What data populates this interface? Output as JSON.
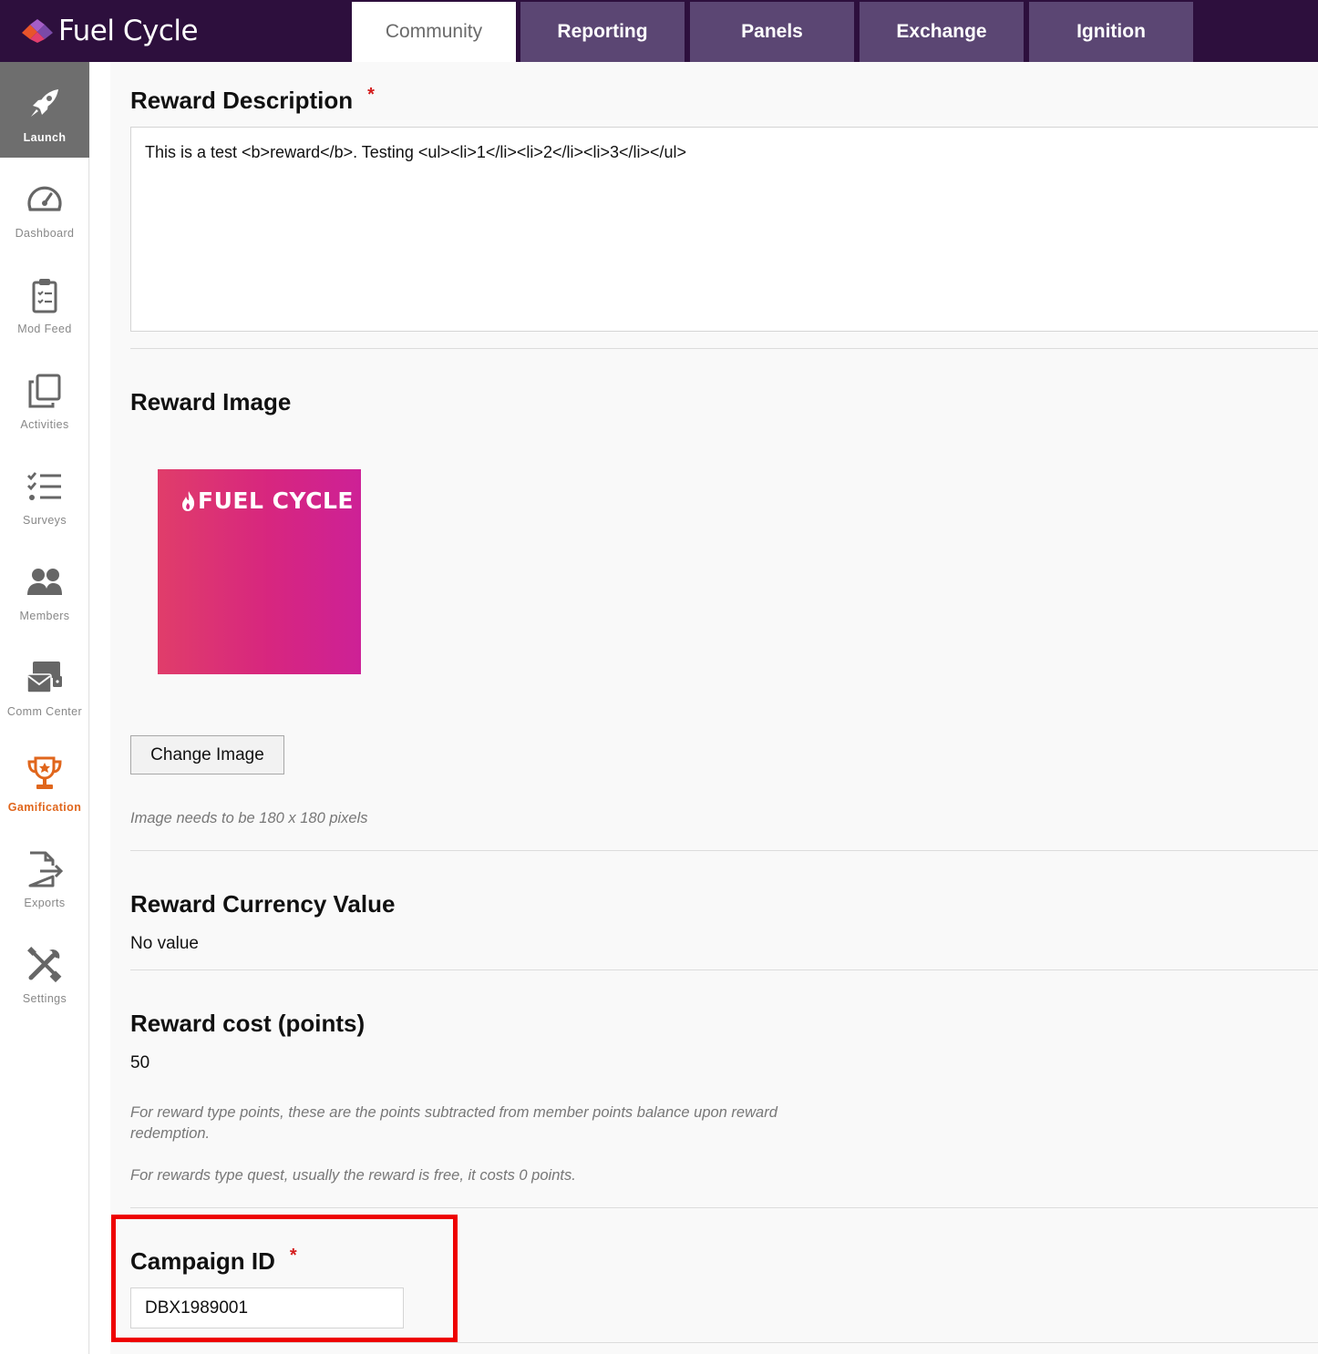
{
  "app": {
    "logo_text": "Fuel Cycle",
    "logo_icon": "fuel-cycle-logo-icon"
  },
  "tabs": [
    {
      "label": "Community",
      "active": true
    },
    {
      "label": "Reporting",
      "active": false
    },
    {
      "label": "Panels",
      "active": false
    },
    {
      "label": "Exchange",
      "active": false
    },
    {
      "label": "Ignition",
      "active": false
    }
  ],
  "sidebar": {
    "items": [
      {
        "label": "Launch",
        "icon": "rocket-icon",
        "active": true
      },
      {
        "label": "Dashboard",
        "icon": "gauge-icon",
        "active": false
      },
      {
        "label": "Mod Feed",
        "icon": "clipboard-icon",
        "active": false
      },
      {
        "label": "Activities",
        "icon": "copy-icon",
        "active": false
      },
      {
        "label": "Surveys",
        "icon": "checklist-icon",
        "active": false
      },
      {
        "label": "Members",
        "icon": "users-icon",
        "active": false
      },
      {
        "label": "Comm Center",
        "icon": "mail-chat-icon",
        "active": false
      },
      {
        "label": "Gamification",
        "icon": "trophy-icon",
        "active": false,
        "highlighted": true
      },
      {
        "label": "Exports",
        "icon": "file-export-icon",
        "active": false
      },
      {
        "label": "Settings",
        "icon": "tools-icon",
        "active": false
      }
    ]
  },
  "form": {
    "description": {
      "label": "Reward Description",
      "required_mark": "*",
      "value": "This is a test <b>reward</b>. Testing <ul><li>1</li><li>2</li><li>3</li></ul>"
    },
    "image": {
      "label": "Reward Image",
      "image_text": "FUEL CYCLE",
      "change_button": "Change Image",
      "help": "Image needs to be 180 x 180 pixels"
    },
    "currency": {
      "label": "Reward Currency Value",
      "value": "No value"
    },
    "cost": {
      "label": "Reward cost (points)",
      "value": "50",
      "help1": "For reward type points, these are the points subtracted from member points balance upon reward redemption.",
      "help2": "For rewards type quest, usually the reward is free, it costs 0 points."
    },
    "campaign": {
      "label": "Campaign ID",
      "required_mark": "*",
      "value": "DBX1989001"
    }
  },
  "colors": {
    "topbar": "#2d0f3d",
    "tab": "#5b4673",
    "accent_orange": "#e0661c",
    "required": "#d31c1c",
    "highlight_box": "#ee0000"
  }
}
